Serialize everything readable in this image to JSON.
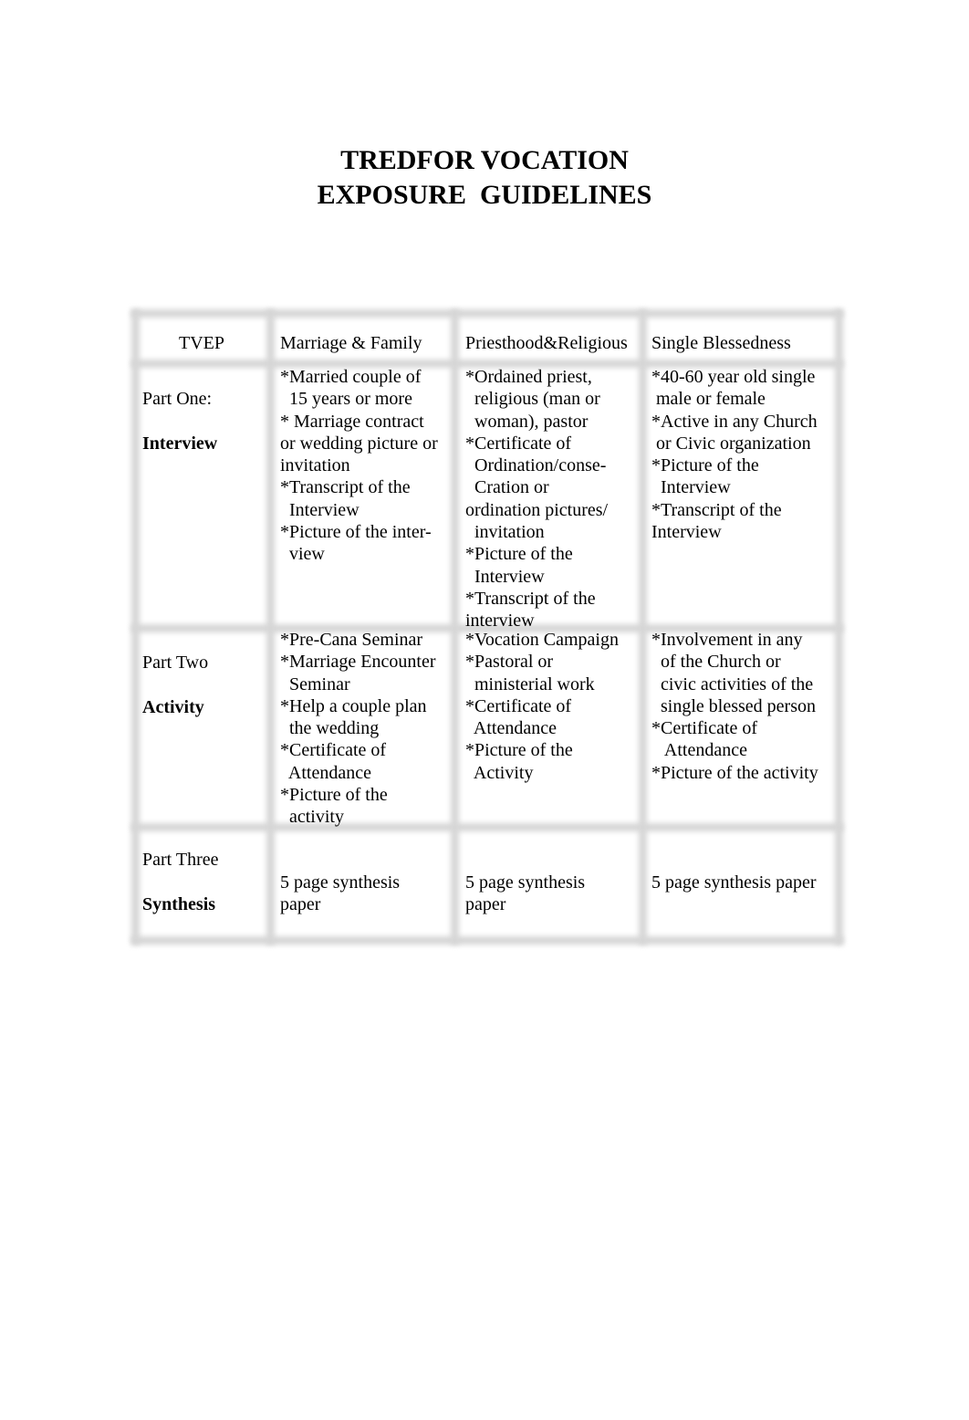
{
  "title": {
    "line1": "TREDFOR VOCATION",
    "line2": "EXPOSURE  GUIDELINES"
  },
  "table": {
    "headers": [
      "TVEP",
      "Marriage & Family",
      "Priesthood&Religious",
      "Single Blessedness"
    ],
    "rows": [
      {
        "part": "Part One:",
        "name": "Interview",
        "cells": [
          [
            "*Married couple of",
            "  15 years or more",
            "* Marriage contract",
            "or wedding picture or",
            "invitation",
            "*Transcript of the",
            "  Interview",
            "*Picture of the inter-",
            "  view"
          ],
          [
            "*Ordained priest,",
            "  religious (man or",
            "  woman), pastor",
            "*Certificate of",
            "  Ordination/conse-",
            "  Cration or",
            "ordination pictures/",
            "  invitation",
            "*Picture of the",
            "  Interview",
            "*Transcript of the",
            "interview"
          ],
          [
            "*40-60 year old single",
            " male or female",
            "*Active in any Church",
            " or Civic organization",
            "*Picture of the",
            "  Interview",
            "*Transcript of the",
            "Interview"
          ]
        ]
      },
      {
        "part": "Part Two",
        "name": "Activity",
        "cells": [
          [
            "*Pre-Cana Seminar",
            "*Marriage Encounter",
            "  Seminar",
            "*Help a couple plan",
            "  the wedding",
            "*Certificate of",
            "  Attendance",
            "*Picture of the",
            "  activity"
          ],
          [
            "*Vocation Campaign",
            "*Pastoral or",
            "  ministerial work",
            "*Certificate of",
            "  Attendance",
            "*Picture of the",
            "  Activity"
          ],
          [
            "*Involvement in any",
            "  of the Church or",
            "  civic activities of the",
            "  single blessed person",
            "*Certificate of",
            "   Attendance",
            "*Picture of the activity"
          ]
        ]
      },
      {
        "part": "Part Three",
        "name": "Synthesis",
        "cells": [
          [
            "5 page synthesis",
            "paper"
          ],
          [
            "5 page synthesis",
            "paper"
          ],
          [
            "5 page synthesis paper"
          ]
        ]
      }
    ]
  }
}
